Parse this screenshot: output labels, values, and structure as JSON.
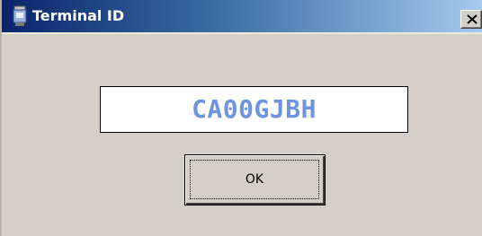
{
  "window": {
    "title": "Terminal ID",
    "icon": "terminal-icon",
    "close_icon": "close-icon"
  },
  "terminal": {
    "id_value": "CA00GJBH"
  },
  "buttons": {
    "ok_label": "OK"
  },
  "colors": {
    "titlebar_start": "#0a246a",
    "titlebar_end": "#a6caf0",
    "dialog_background": "#d4d0c8",
    "id_text": "#6f93e0"
  }
}
